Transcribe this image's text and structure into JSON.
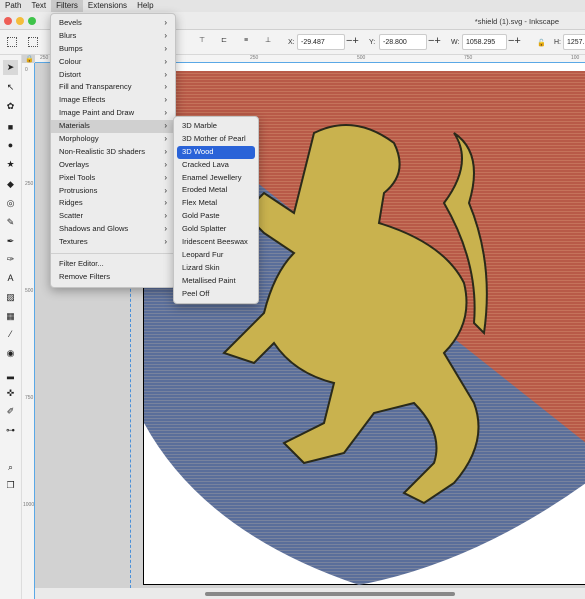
{
  "menubar": {
    "items": [
      "Path",
      "Text",
      "Filters",
      "Extensions",
      "Help"
    ],
    "active": "Filters"
  },
  "window": {
    "title": "*shield (1).svg - Inkscape"
  },
  "toolbar": {
    "x_label": "X:",
    "x_value": "-29.487",
    "y_label": "Y:",
    "y_value": "-28.800",
    "w_label": "W:",
    "w_value": "1058.295",
    "h_label": "H:",
    "h_value": "1257."
  },
  "rulers": {
    "h_ticks": [
      "250",
      "250",
      "500",
      "750",
      "100"
    ],
    "v_ticks": [
      "0",
      "250",
      "500",
      "750",
      "1000"
    ]
  },
  "filters_menu": {
    "items": [
      {
        "label": "Bevels",
        "submenu": true
      },
      {
        "label": "Blurs",
        "submenu": true
      },
      {
        "label": "Bumps",
        "submenu": true
      },
      {
        "label": "Colour",
        "submenu": true
      },
      {
        "label": "Distort",
        "submenu": true
      },
      {
        "label": "Fill and Transparency",
        "submenu": true
      },
      {
        "label": "Image Effects",
        "submenu": true
      },
      {
        "label": "Image Paint and Draw",
        "submenu": true
      },
      {
        "label": "Materials",
        "submenu": true,
        "highlighted": true
      },
      {
        "label": "Morphology",
        "submenu": true
      },
      {
        "label": "Non-Realistic 3D shaders",
        "submenu": true
      },
      {
        "label": "Overlays",
        "submenu": true
      },
      {
        "label": "Pixel Tools",
        "submenu": true
      },
      {
        "label": "Protrusions",
        "submenu": true
      },
      {
        "label": "Ridges",
        "submenu": true
      },
      {
        "label": "Scatter",
        "submenu": true
      },
      {
        "label": "Shadows and Glows",
        "submenu": true
      },
      {
        "label": "Textures",
        "submenu": true
      }
    ],
    "extra_items": [
      "Filter Editor...",
      "Remove Filters"
    ]
  },
  "materials_submenu": {
    "items": [
      "3D Marble",
      "3D Mother of Pearl",
      "3D Wood",
      "Cracked Lava",
      "Enamel Jewellery",
      "Eroded Metal",
      "Flex Metal",
      "Gold Paste",
      "Gold Splatter",
      "Iridescent Beeswax",
      "Leopard Fur",
      "Lizard Skin",
      "Metallised Paint",
      "Peel Off"
    ],
    "selected": "3D Wood"
  },
  "colors": {
    "accent": "#2a63d8",
    "shield_red": "#b85a48",
    "shield_blue": "#5a6e9a",
    "lion_gold": "#c9b24e"
  },
  "tools": [
    "selector-icon",
    "node-icon",
    "tweak-icon",
    "rect-icon",
    "ellipse-icon",
    "star-icon",
    "3dbox-icon",
    "spiral-icon",
    "pencil-icon",
    "pen-icon",
    "calligraphy-icon",
    "text-icon",
    "gradient-icon",
    "mesh-icon",
    "dropper-icon",
    "paint-bucket-icon",
    "eraser-icon",
    "spray-icon",
    "measure-icon",
    "connector-icon",
    "zoom-icon",
    "pages-icon"
  ]
}
